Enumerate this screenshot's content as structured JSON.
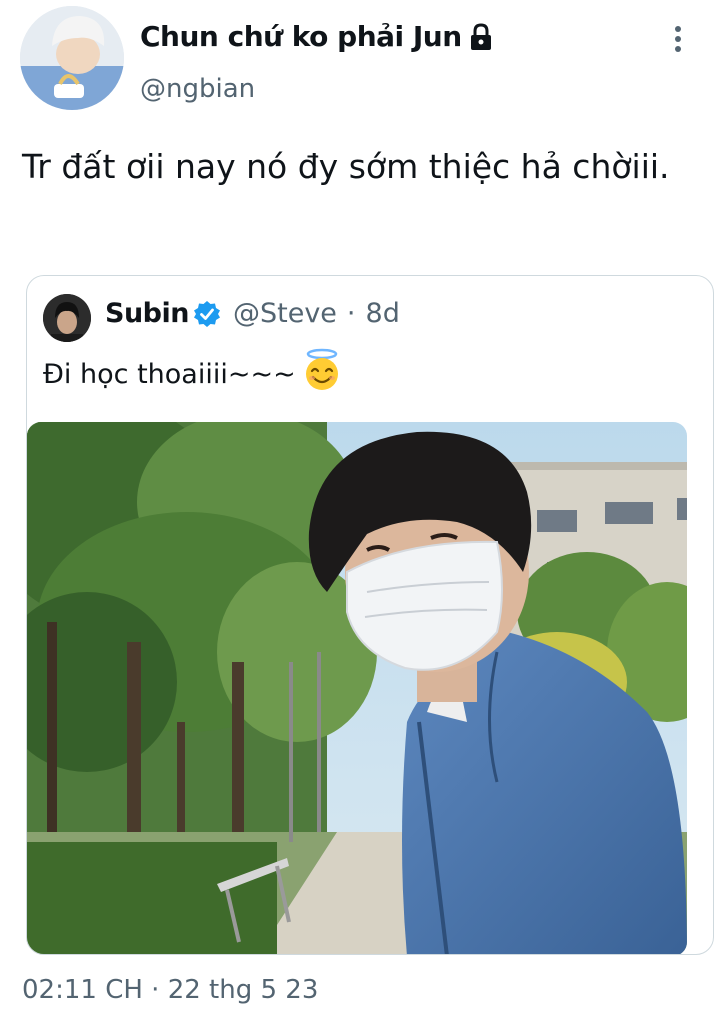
{
  "author": {
    "display_name": "Chun chứ ko phải Jun",
    "handle": "@ngbian",
    "protected_icon": "lock-icon"
  },
  "tweet": {
    "text": "Tr đất ơii nay nó đy sớm thiệc hả chờiii.",
    "timestamp": "02:11 CH · 22 thg 5 23"
  },
  "quote": {
    "display_name": "Subin",
    "handle": "@Steve",
    "separator": "·",
    "age": "8d",
    "text": "Đi học thoaiiii~~~",
    "emoji_icon": "smiling-face-with-halo-icon",
    "verified_icon": "verified-badge-icon"
  },
  "colors": {
    "text": "#0f1419",
    "secondary": "#536471",
    "verified": "#1d9bf0",
    "border": "#cfd9de"
  }
}
